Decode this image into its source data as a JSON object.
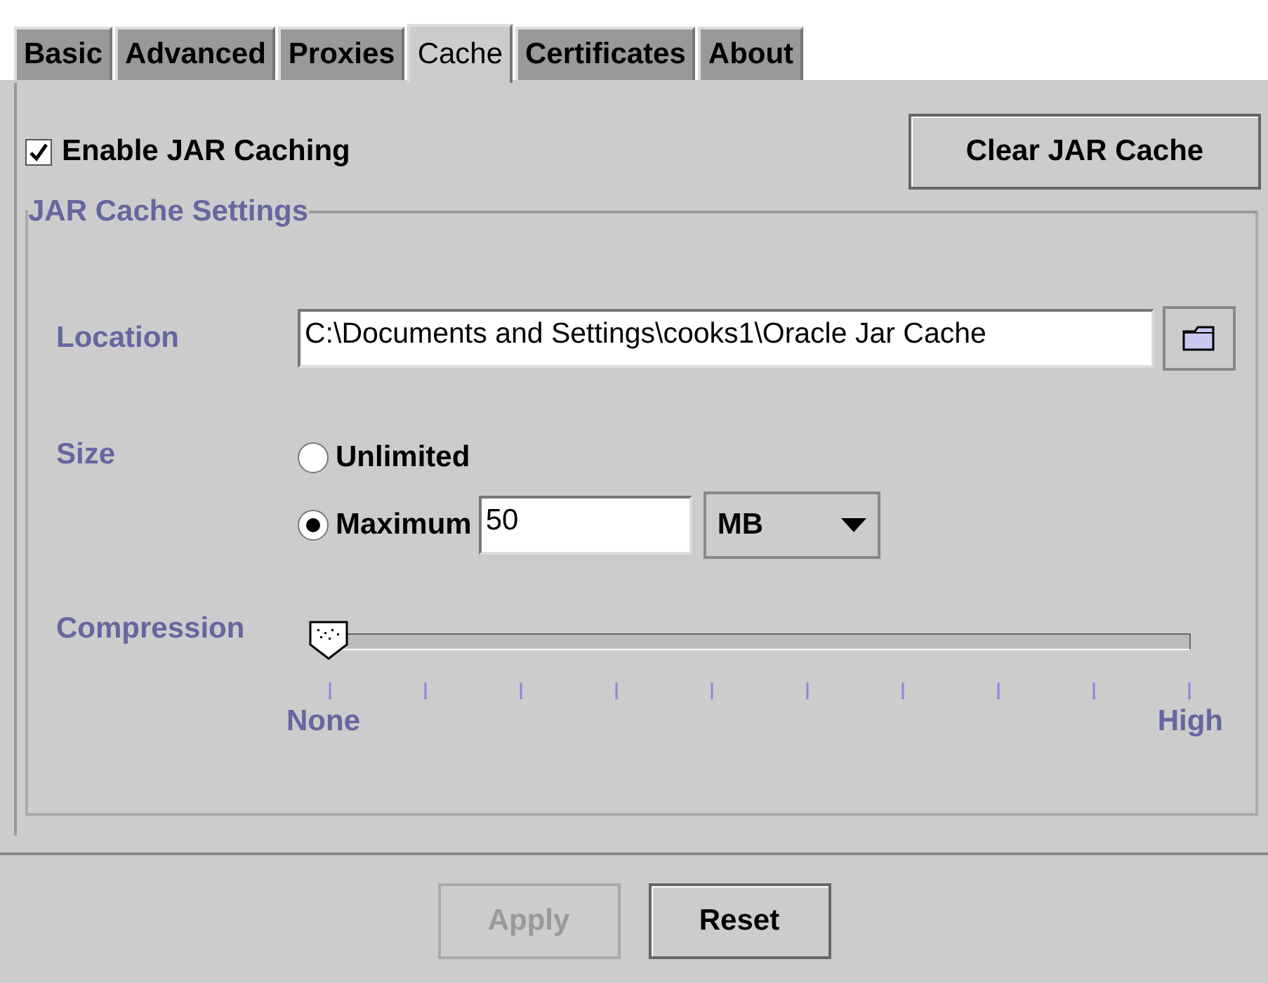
{
  "tabs": [
    {
      "label": "Basic",
      "selected": false
    },
    {
      "label": "Advanced",
      "selected": false
    },
    {
      "label": "Proxies",
      "selected": false
    },
    {
      "label": "Cache",
      "selected": true
    },
    {
      "label": "Certificates",
      "selected": false
    },
    {
      "label": "About",
      "selected": false
    }
  ],
  "enable_caching": {
    "label": "Enable JAR Caching",
    "checked": true
  },
  "clear_button": "Clear JAR Cache",
  "settings": {
    "title": "JAR Cache Settings",
    "location": {
      "label": "Location",
      "value": "C:\\Documents and Settings\\cooks1\\Oracle Jar Cache"
    },
    "size": {
      "label": "Size",
      "options": [
        {
          "label": "Unlimited",
          "selected": false
        },
        {
          "label": "Maximum",
          "selected": true
        }
      ],
      "value": "50",
      "unit": "MB"
    },
    "compression": {
      "label": "Compression",
      "level": 0,
      "min_label": "None",
      "max_label": "High"
    }
  },
  "buttons": [
    {
      "label": "Apply",
      "disabled": true
    },
    {
      "label": "Reset",
      "disabled": false
    }
  ]
}
